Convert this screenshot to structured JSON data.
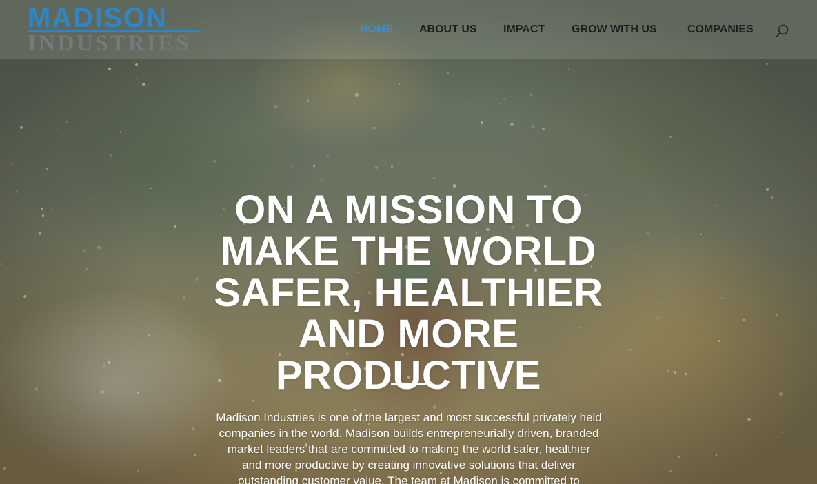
{
  "brand": {
    "logo_top": "MADISON",
    "logo_bottom": "INDUSTRIES",
    "primary_color": "#2e86c6",
    "secondary_color": "#777a7c"
  },
  "nav": {
    "items": [
      {
        "label": "HOME",
        "active": true
      },
      {
        "label": "ABOUT US",
        "active": false
      },
      {
        "label": "IMPACT",
        "active": false
      },
      {
        "label": "GROW WITH US",
        "active": false
      },
      {
        "label": "COMPANIES",
        "active": false
      }
    ],
    "active_color": "#3b8fcf",
    "search_icon": "search-icon"
  },
  "hero": {
    "title_lines": [
      "ON A MISSION TO",
      "MAKE THE WORLD",
      "SAFER, HEALTHIER",
      "AND MORE",
      "PRODUCTIVE"
    ],
    "body_lines": [
      "Madison Industries is one of the largest and most successful privately held",
      "companies in the world. Madison builds entrepreneurially driven, branded",
      "market leaders that are committed to making the world safer, healthier",
      "and more productive by creating innovative solutions that deliver",
      "outstanding customer value. The team at Madison is committed to"
    ]
  }
}
